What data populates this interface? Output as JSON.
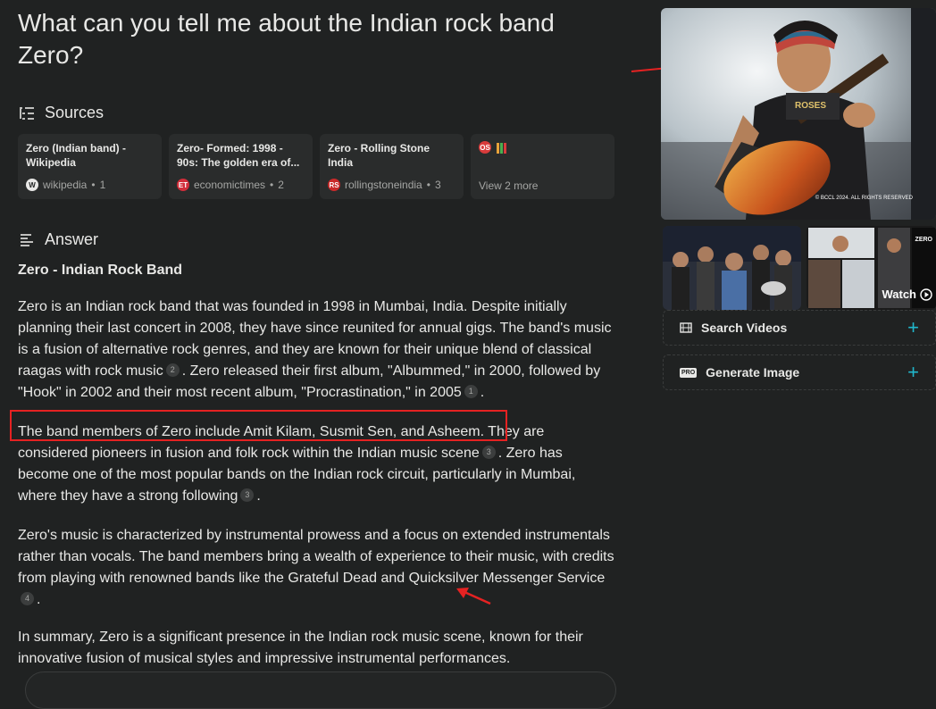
{
  "question": "What can you tell me about the Indian rock band Zero?",
  "sources_heading": "Sources",
  "sources": [
    {
      "title": "Zero (Indian band) - Wikipedia",
      "domain": "wikipedia",
      "index": "1",
      "favicon": "W",
      "favicon_color": "#e8e8e6"
    },
    {
      "title": "Zero- Formed: 1998 - 90s: The golden era of...",
      "domain": "economictimes",
      "index": "2",
      "favicon": "ET",
      "favicon_color": "#d12d3a"
    },
    {
      "title": "Zero - Rolling Stone India",
      "domain": "rollingstoneindia",
      "index": "3",
      "favicon": "RS",
      "favicon_color": "#c92a2a"
    }
  ],
  "sources_more": {
    "label": "View 2 more",
    "favicons": [
      "OS",
      "bars"
    ]
  },
  "answer_heading": "Answer",
  "answer_title": "Zero - Indian Rock Band",
  "paragraphs": {
    "p1": {
      "text": "Zero is an Indian rock band that was founded in 1998 in Mumbai, India. Despite initially planning their last concert in 2008, they have since reunited for annual gigs. The band's music is a fusion of alternative rock genres, and they are known for their unique blend of classical raagas with rock music",
      "cite_a": "2",
      "text2": ". Zero released their first album, \"Albummed,\" in 2000, followed by \"Hook\" in 2002 and their most recent album, \"Procrastination,\" in 2005",
      "cite_b": "1",
      "text3": "."
    },
    "p2": {
      "text": "The band members of Zero include Amit Kilam, Susmit Sen, and Asheem. They are considered pioneers in fusion and folk rock within the Indian music scene",
      "cite_a": "3",
      "text2": ". Zero has become one of the most popular bands on the Indian rock circuit, particularly in Mumbai, where they have a strong following",
      "cite_b": "3",
      "text3": "."
    },
    "p3": {
      "text": "Zero's music is characterized by instrumental prowess and a focus on extended instrumentals rather than vocals. The band members bring a wealth of experience to their music, with credits from playing with renowned bands like the Grateful Dead and Quicksilver Messenger Service",
      "cite_a": "4",
      "text2": "."
    },
    "p4": {
      "text": "In summary, Zero is a significant presence in the Indian rock music scene, known for their innovative fusion of musical styles and impressive instrumental performances."
    }
  },
  "side": {
    "hero_watermark": "© BCCL 2024. ALL RIGHTS RESERVED",
    "thumb_text": "ZERO",
    "watch_label": "Watch",
    "search_videos_label": "Search Videos",
    "generate_image_label": "Generate Image",
    "pro_badge": "PRO"
  },
  "colors": {
    "accent": "#20b8cd",
    "annotation": "#e52222",
    "background": "#202222"
  }
}
